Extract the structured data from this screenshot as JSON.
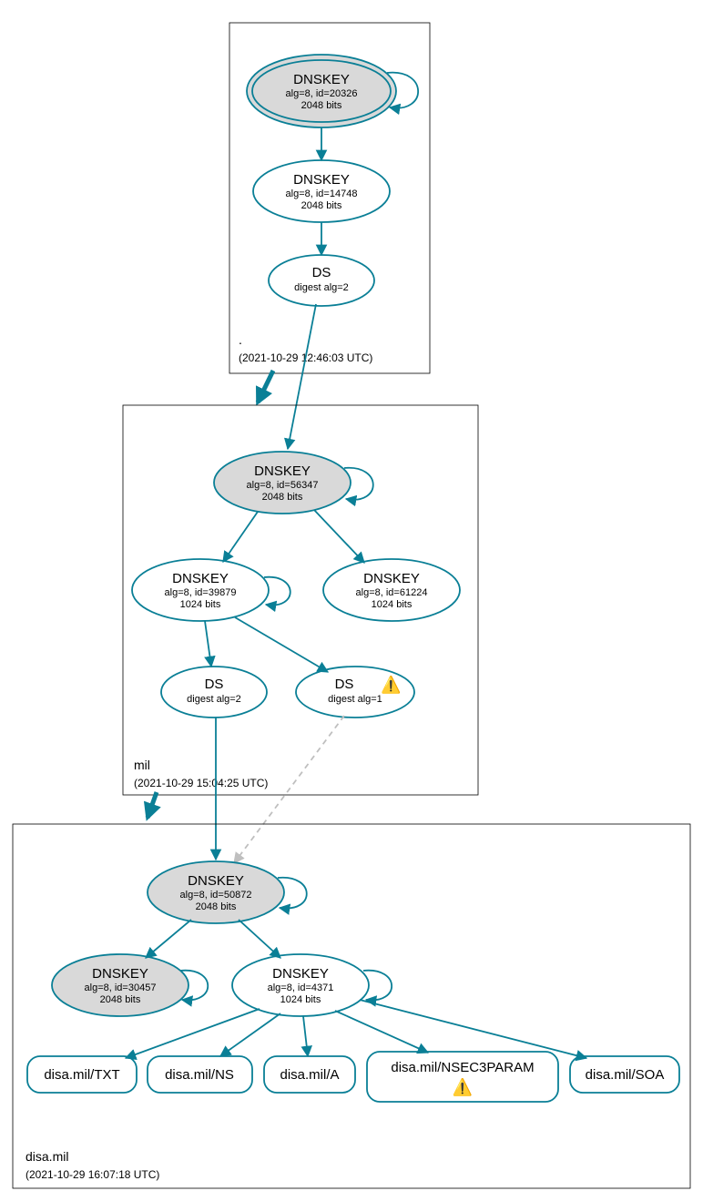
{
  "colors": {
    "accent": "#0a7f96",
    "node_fill_ksk": "#d9d9d9"
  },
  "zones": {
    "root": {
      "name": ".",
      "timestamp": "(2021-10-29 12:46:03 UTC)"
    },
    "mil": {
      "name": "mil",
      "timestamp": "(2021-10-29 15:04:25 UTC)"
    },
    "disa": {
      "name": "disa.mil",
      "timestamp": "(2021-10-29 16:07:18 UTC)"
    }
  },
  "nodes": {
    "root_ksk": {
      "title": "DNSKEY",
      "sub1": "alg=8, id=20326",
      "sub2": "2048 bits"
    },
    "root_zsk": {
      "title": "DNSKEY",
      "sub1": "alg=8, id=14748",
      "sub2": "2048 bits"
    },
    "root_ds": {
      "title": "DS",
      "sub1": "digest alg=2"
    },
    "mil_ksk": {
      "title": "DNSKEY",
      "sub1": "alg=8, id=56347",
      "sub2": "2048 bits"
    },
    "mil_zsk_a": {
      "title": "DNSKEY",
      "sub1": "alg=8, id=39879",
      "sub2": "1024 bits"
    },
    "mil_zsk_b": {
      "title": "DNSKEY",
      "sub1": "alg=8, id=61224",
      "sub2": "1024 bits"
    },
    "mil_ds_a": {
      "title": "DS",
      "sub1": "digest alg=2"
    },
    "mil_ds_b": {
      "title": "DS",
      "sub1": "digest alg=1"
    },
    "disa_ksk": {
      "title": "DNSKEY",
      "sub1": "alg=8, id=50872",
      "sub2": "2048 bits"
    },
    "disa_ksk2": {
      "title": "DNSKEY",
      "sub1": "alg=8, id=30457",
      "sub2": "2048 bits"
    },
    "disa_zsk": {
      "title": "DNSKEY",
      "sub1": "alg=8, id=4371",
      "sub2": "1024 bits"
    }
  },
  "rrsets": {
    "txt": {
      "label": "disa.mil/TXT"
    },
    "ns": {
      "label": "disa.mil/NS"
    },
    "a": {
      "label": "disa.mil/A"
    },
    "nsec3": {
      "label": "disa.mil/NSEC3PARAM"
    },
    "soa": {
      "label": "disa.mil/SOA"
    }
  },
  "icons": {
    "warning": "⚠️"
  }
}
